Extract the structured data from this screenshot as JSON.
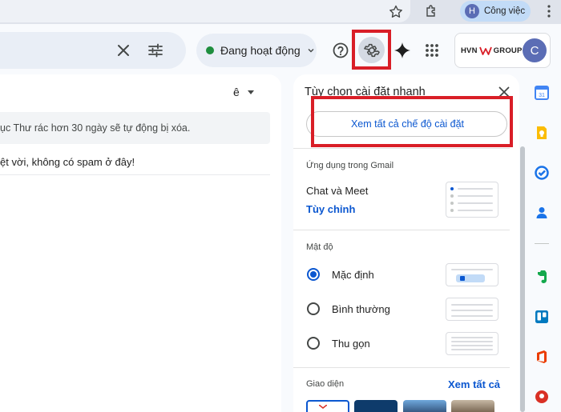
{
  "browser": {
    "profile_initial": "H",
    "profile_name": "Công việc"
  },
  "header": {
    "status_label": "Đang hoạt động",
    "org_logo_left": "HVN",
    "org_logo_right": "GROUP",
    "account_initial": "C"
  },
  "mail": {
    "sort_label": "ê",
    "notice": "ục Thư rác hơn 30 ngày sẽ tự động bị xóa.",
    "empty_message": "ệt vời, không có spam ở đây!"
  },
  "quick_settings": {
    "title": "Tùy chọn cài đặt nhanh",
    "see_all_settings": "Xem tất cả chế độ cài đặt",
    "apps_section": "Ứng dụng trong Gmail",
    "chat_meet": "Chat và Meet",
    "customize": "Tùy chỉnh",
    "density_section": "Mật độ",
    "density_options": [
      {
        "label": "Mặc định",
        "selected": true
      },
      {
        "label": "Bình thường",
        "selected": false
      },
      {
        "label": "Thu gọn",
        "selected": false
      }
    ],
    "theme_section": "Giao diện",
    "theme_see_all": "Xem tất cả"
  },
  "side_apps": [
    "calendar-icon",
    "keep-icon",
    "tasks-icon",
    "contacts-icon",
    "evernote-icon",
    "trello-icon",
    "office-icon",
    "addon-icon"
  ],
  "colors": {
    "highlight": "#d91e27",
    "link_blue": "#0b57d0",
    "status_green": "#1e8e3e"
  }
}
